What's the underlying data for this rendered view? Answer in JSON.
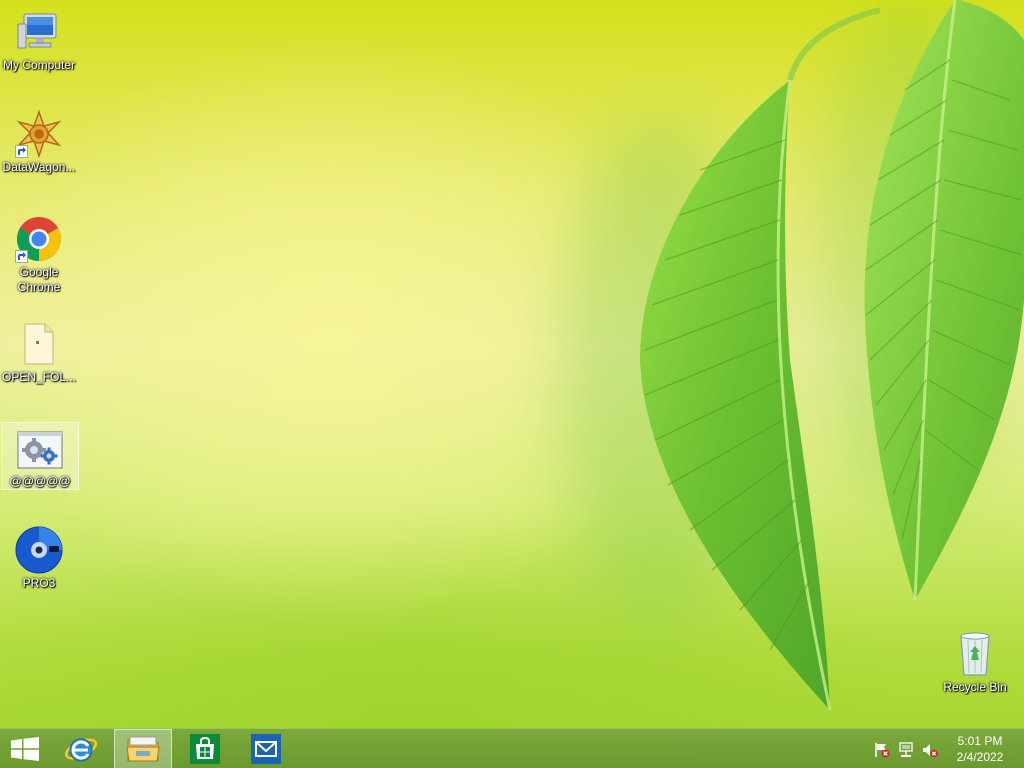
{
  "desktop": {
    "icons": [
      {
        "label": "My Computer"
      },
      {
        "label": "DataWagon..."
      },
      {
        "label": "Google Chrome"
      },
      {
        "label": "OPEN_FOL..."
      },
      {
        "label": "@@@@@"
      },
      {
        "label": "PRO3"
      }
    ],
    "recycle_bin": {
      "label": "Recycle Bin"
    }
  },
  "taskbar": {
    "pinned": [
      "start-button",
      "internet-explorer",
      "file-explorer",
      "windows-store",
      "mail"
    ],
    "active_item": "file-explorer",
    "tray": {
      "icons": [
        "action-center-flag-icon",
        "network-icon",
        "volume-muted-icon"
      ],
      "time": "5:01 PM",
      "date": "2/4/2022"
    }
  },
  "colors": {
    "wallpaper_top": "#d4e01c",
    "wallpaper_bottom": "#a2d42c",
    "leaf": "#6cc030",
    "taskbar": "#6e9a38",
    "store_green": "#0a8a3a",
    "mail_blue": "#1a64b4"
  }
}
